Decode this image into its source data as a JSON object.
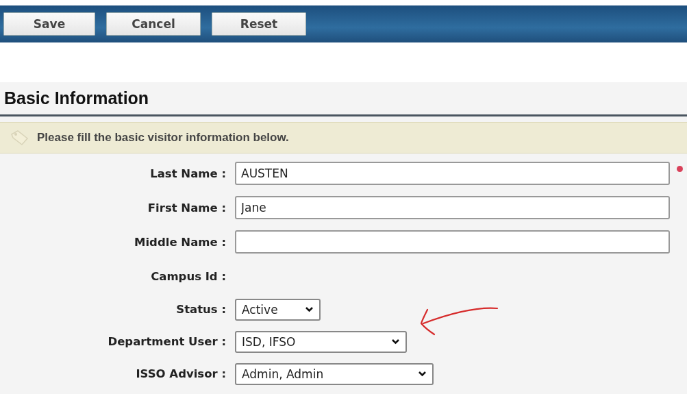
{
  "toolbar": {
    "buttons": [
      "Save",
      "Cancel",
      "Reset"
    ]
  },
  "section": {
    "title": "Basic Information",
    "hint": "Please fill the basic visitor information below."
  },
  "fields": [
    {
      "label": "Last Name :",
      "kind": "text",
      "value": "AUSTEN",
      "required": true
    },
    {
      "label": "First Name :",
      "kind": "text",
      "value": "Jane",
      "required": false
    },
    {
      "label": "Middle Name :",
      "kind": "text",
      "required": false
    },
    {
      "label": "Campus Id :",
      "kind": "readonly"
    },
    {
      "label": "Status :",
      "kind": "select",
      "value": "Active"
    },
    {
      "label": "Department User :",
      "kind": "select",
      "value": "ISD, IFSO",
      "annotated": true
    },
    {
      "label": "ISSO Advisor :",
      "kind": "select",
      "value": "Admin, Admin"
    }
  ]
}
